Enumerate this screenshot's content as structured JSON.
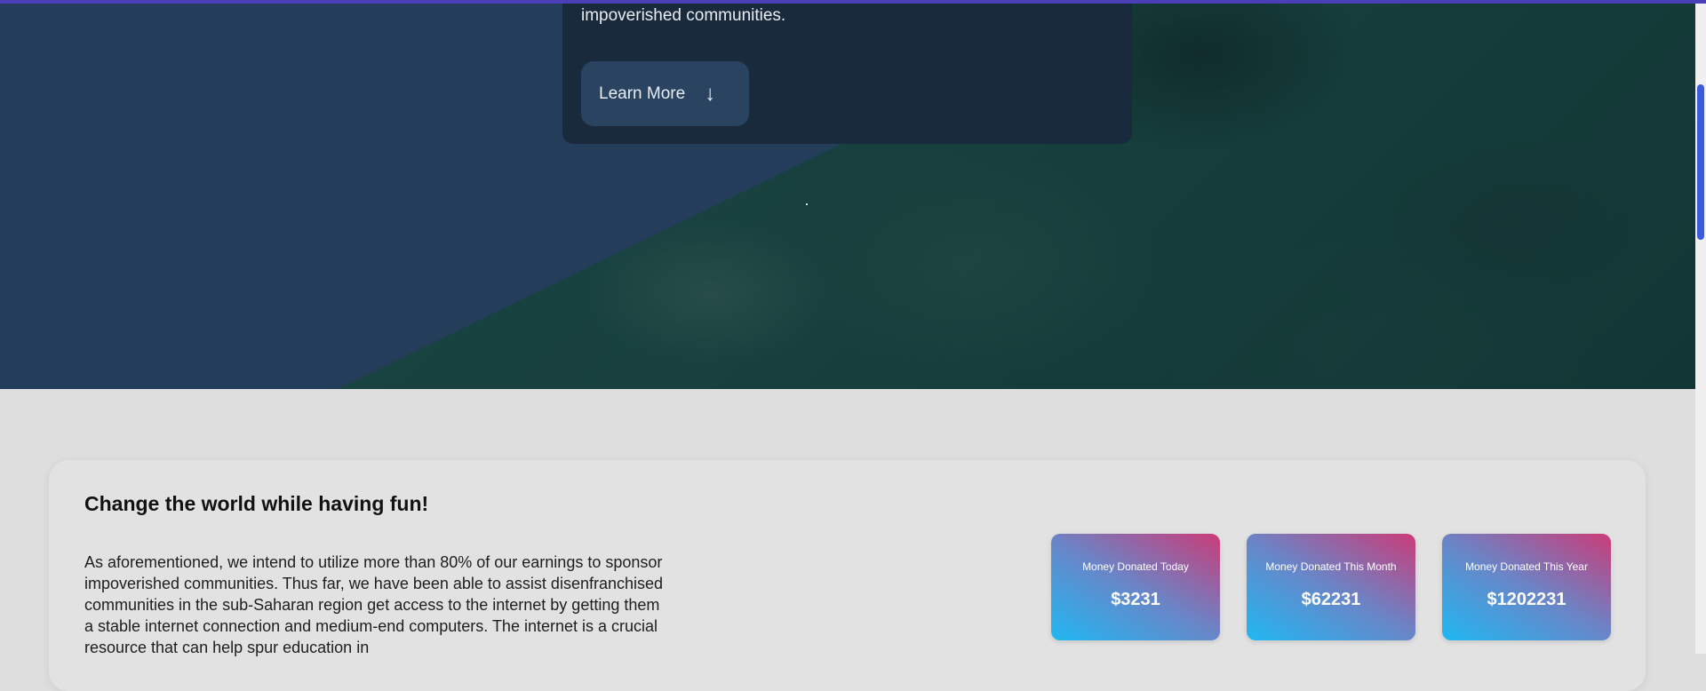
{
  "hero": {
    "text": "impoverished communities.",
    "learn_more_label": "Learn More",
    "learn_more_icon": "arrow-down-icon"
  },
  "content": {
    "title": "Change the world while having fun!",
    "body": "As aforementioned, we intend to utilize more than 80% of our earnings to sponsor impoverished communities. Thus far, we have been able to assist disenfranchised communities in the sub-Saharan region get access to the internet by getting them a stable internet connection and medium-end computers. The internet is a crucial resource that can help spur education in"
  },
  "stats": [
    {
      "label": "Money Donated Today",
      "value": "$3231"
    },
    {
      "label": "Money Donated This Month",
      "value": "$62231"
    },
    {
      "label": "Money Donated This Year",
      "value": "$1202231"
    }
  ],
  "colors": {
    "accent": "#3b5bdb",
    "hero_panel": "#243d5a",
    "stat_gradient_start": "#20b8f2",
    "stat_gradient_end": "#cc3b78"
  }
}
